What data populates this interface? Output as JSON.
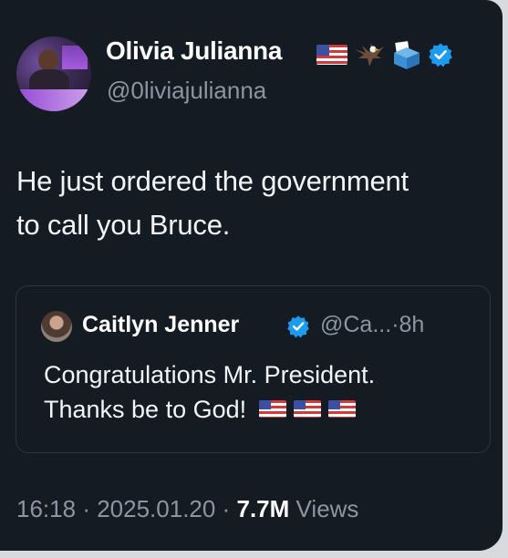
{
  "author": {
    "display_name": "Olivia Julianna",
    "handle": "@0liviajulianna",
    "badges": [
      "us-flag-icon",
      "eagle-icon",
      "ballot-box-icon",
      "verified-badge-icon"
    ]
  },
  "tweet": {
    "text_line_1": "He just ordered the government",
    "text_line_2": "to call you Bruce."
  },
  "quoted_tweet": {
    "display_name": "Caitlyn Jenner",
    "handle_truncated": "@Ca...",
    "separator": "·",
    "age": "8h",
    "text_line_1": "Congratulations Mr. President.",
    "text_line_2": "Thanks be to God!",
    "flags": [
      "us-flag-icon",
      "us-flag-icon",
      "us-flag-icon"
    ]
  },
  "meta": {
    "time": "16:18",
    "separator": "·",
    "date": "2025.01.20",
    "views_count": "7.7M",
    "views_label": "Views"
  },
  "colors": {
    "background": "#151b23",
    "text_primary": "#f2f4f6",
    "text_secondary": "#8b96a3",
    "verified_blue": "#1d9bf0",
    "border": "#2c3540"
  }
}
